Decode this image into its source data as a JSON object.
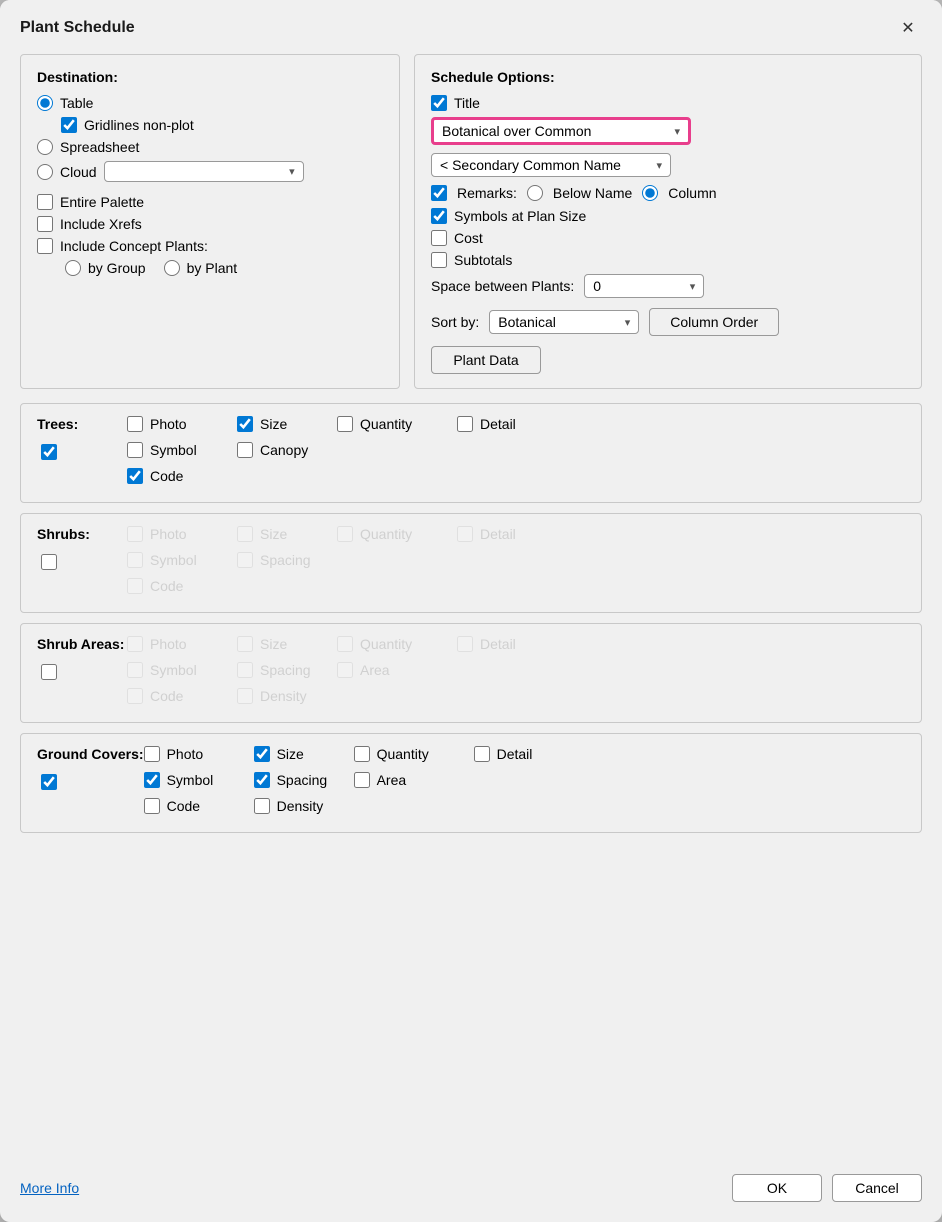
{
  "dialog": {
    "title": "Plant Schedule",
    "close_label": "✕"
  },
  "destination": {
    "label": "Destination:",
    "options": [
      {
        "id": "table",
        "label": "Table",
        "checked": true
      },
      {
        "id": "gridlines",
        "label": "Gridlines non-plot",
        "checked": true,
        "indent": true
      },
      {
        "id": "spreadsheet",
        "label": "Spreadsheet",
        "checked": false
      },
      {
        "id": "cloud",
        "label": "Cloud",
        "checked": false
      }
    ],
    "cloud_dropdown": "",
    "other_options": [
      {
        "id": "entire_palette",
        "label": "Entire Palette",
        "checked": false
      },
      {
        "id": "include_xrefs",
        "label": "Include Xrefs",
        "checked": false
      },
      {
        "id": "include_concept",
        "label": "Include Concept Plants:",
        "checked": false
      }
    ],
    "concept_sub": [
      {
        "id": "by_group",
        "label": "by Group"
      },
      {
        "id": "by_plant",
        "label": "by Plant"
      }
    ]
  },
  "schedule_options": {
    "label": "Schedule Options:",
    "title_checked": true,
    "title_label": "Title",
    "botanical_dropdown": "Botanical over Common",
    "secondary_dropdown": "< Secondary Common Name",
    "remarks_checked": true,
    "remarks_label": "Remarks:",
    "below_name_label": "Below Name",
    "column_label": "Column",
    "column_checked": true,
    "symbols_checked": true,
    "symbols_label": "Symbols at Plan Size",
    "cost_checked": false,
    "cost_label": "Cost",
    "subtotals_checked": false,
    "subtotals_label": "Subtotals",
    "space_between_label": "Space between Plants:",
    "space_value": "0",
    "sort_by_label": "Sort by:",
    "sort_value": "Botanical",
    "column_order_label": "Column Order",
    "plant_data_label": "Plant Data"
  },
  "trees": {
    "label": "Trees:",
    "main_checked": true,
    "photo_label": "Photo",
    "photo_checked": false,
    "symbol_label": "Symbol",
    "symbol_checked": false,
    "code_label": "Code",
    "code_checked": true,
    "size_label": "Size",
    "size_checked": true,
    "canopy_label": "Canopy",
    "canopy_checked": false,
    "quantity_label": "Quantity",
    "quantity_checked": false,
    "detail_label": "Detail",
    "detail_checked": false,
    "disabled": false
  },
  "shrubs": {
    "label": "Shrubs:",
    "main_checked": false,
    "photo_label": "Photo",
    "photo_checked": false,
    "symbol_label": "Symbol",
    "symbol_checked": false,
    "code_label": "Code",
    "code_checked": false,
    "size_label": "Size",
    "size_checked": false,
    "spacing_label": "Spacing",
    "spacing_checked": false,
    "quantity_label": "Quantity",
    "quantity_checked": false,
    "detail_label": "Detail",
    "detail_checked": false,
    "disabled": true
  },
  "shrub_areas": {
    "label": "Shrub Areas:",
    "main_checked": false,
    "photo_label": "Photo",
    "photo_checked": false,
    "symbol_label": "Symbol",
    "symbol_checked": false,
    "code_label": "Code",
    "code_checked": false,
    "size_label": "Size",
    "size_checked": false,
    "spacing_label": "Spacing",
    "spacing_checked": false,
    "density_label": "Density",
    "density_checked": false,
    "quantity_label": "Quantity",
    "quantity_checked": false,
    "area_label": "Area",
    "area_checked": false,
    "detail_label": "Detail",
    "detail_checked": false,
    "disabled": true
  },
  "ground_covers": {
    "label": "Ground Covers:",
    "main_checked": true,
    "photo_label": "Photo",
    "photo_checked": false,
    "symbol_label": "Symbol",
    "symbol_checked": true,
    "code_label": "Code",
    "code_checked": false,
    "size_label": "Size",
    "size_checked": true,
    "spacing_label": "Spacing",
    "spacing_checked": true,
    "density_label": "Density",
    "density_checked": false,
    "quantity_label": "Quantity",
    "quantity_checked": false,
    "area_label": "Area",
    "area_checked": false,
    "detail_label": "Detail",
    "detail_checked": false,
    "disabled": false
  },
  "footer": {
    "more_info_label": "More Info",
    "ok_label": "OK",
    "cancel_label": "Cancel"
  }
}
